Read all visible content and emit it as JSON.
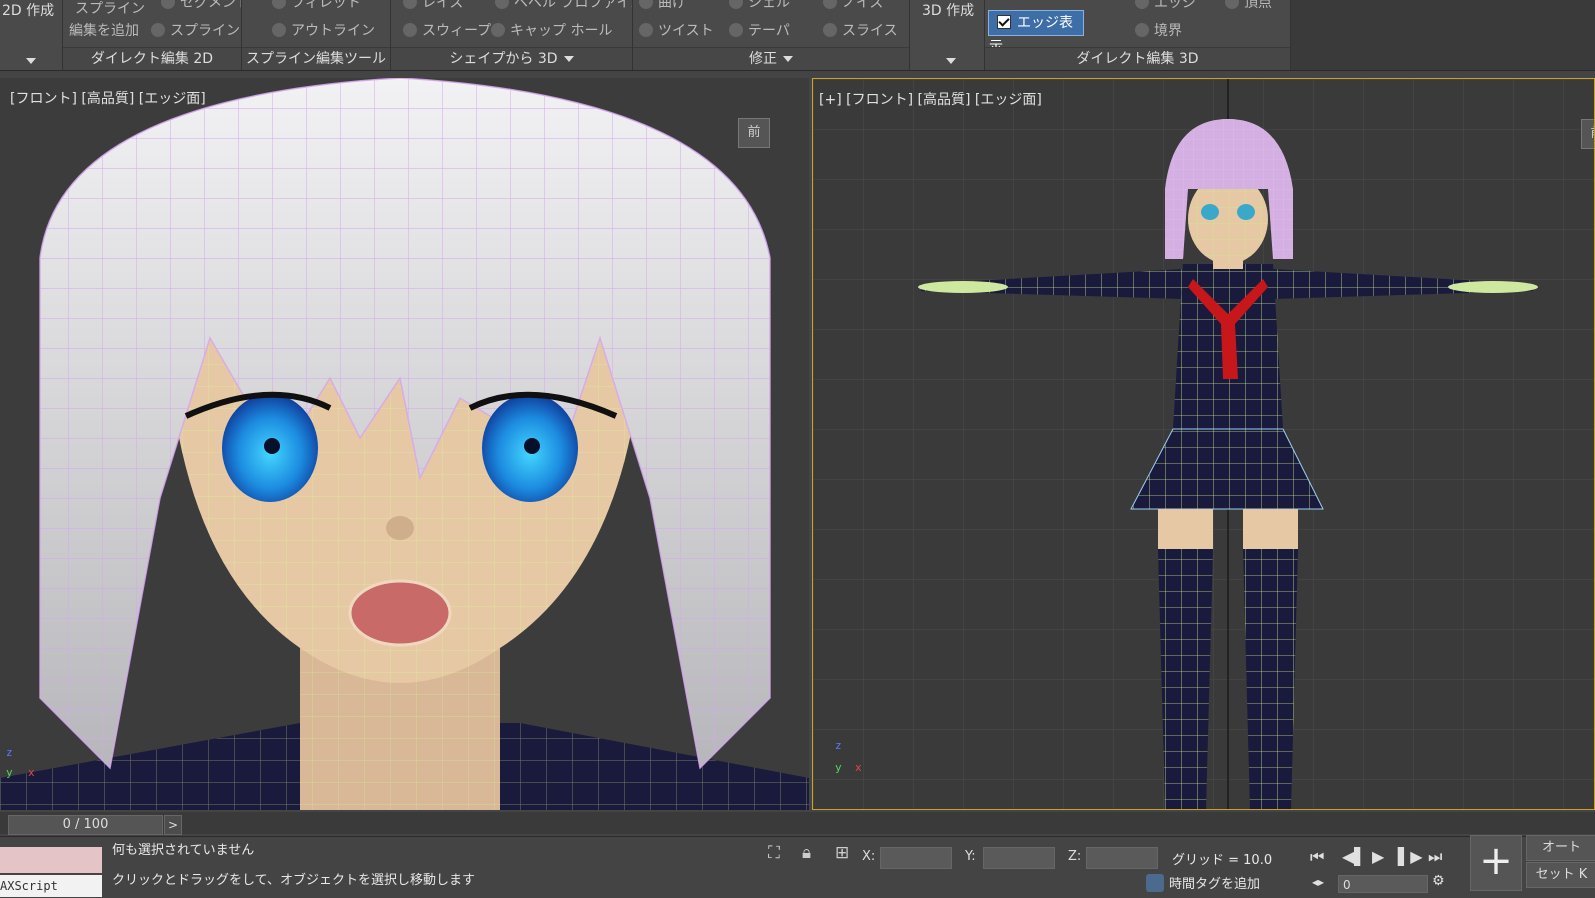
{
  "ribbon": {
    "create2d_label": "2D 作成",
    "direct2d": {
      "spline": "スプライン",
      "add_edit": "編集を追加",
      "segment": "セグメント",
      "spline2": "スプライン",
      "group_label": "ダイレクト編集 2D"
    },
    "spline_tools": {
      "fillet": "フィレット",
      "outline": "アウトライン",
      "group_label": "スプライン編集ツール"
    },
    "shape_to_3d": {
      "lathe": "レイズ",
      "bevel": "ベベル プロファイル",
      "sweep": "スウィープ",
      "cap": "キャップ ホール",
      "group_label": "シェイプから 3D"
    },
    "modify": {
      "bend": "曲げ",
      "shell": "シェル",
      "noise": "ノイズ",
      "twist": "ツイスト",
      "taper": "テーパ",
      "slice": "スライス",
      "group_label": "修正"
    },
    "create3d_label": "3D 作成",
    "direct3d": {
      "edge_toggle": "エッジ表示",
      "edge": "エッジ",
      "vertex": "頂点",
      "border": "境界",
      "group_label": "ダイレクト編集 3D"
    }
  },
  "viewport_left": {
    "label": "[フロント] [高品質] [エッジ面]",
    "viewcube": "前"
  },
  "viewport_right": {
    "label": "[+] [フロント] [高品質] [エッジ面]",
    "viewcube": "前"
  },
  "axes": {
    "z": "z",
    "y": "y",
    "x": "x"
  },
  "timeline": {
    "frame": "0 / 100",
    "next": ">"
  },
  "status": {
    "maxscript": "AXScript",
    "line1": "何も選択されていません",
    "line2": "クリックとドラッグをして、オブジェクトを選択し移動します",
    "x_label": "X:",
    "y_label": "Y:",
    "z_label": "Z:",
    "grid": "グリッド = 10.0",
    "add_time_tag": "時間タグを追加",
    "frame_value": "0",
    "auto": "オート",
    "set_key": "セット K"
  },
  "colors": {
    "accent": "#3e6ea8",
    "viewport_active_border": "#c9a227",
    "wire_skin": "#d9ef9a",
    "wire_hair": "#d9a8f2",
    "uniform": "#1a1a3c",
    "eye": "#1e8fe0",
    "scarf": "#c8171b"
  }
}
